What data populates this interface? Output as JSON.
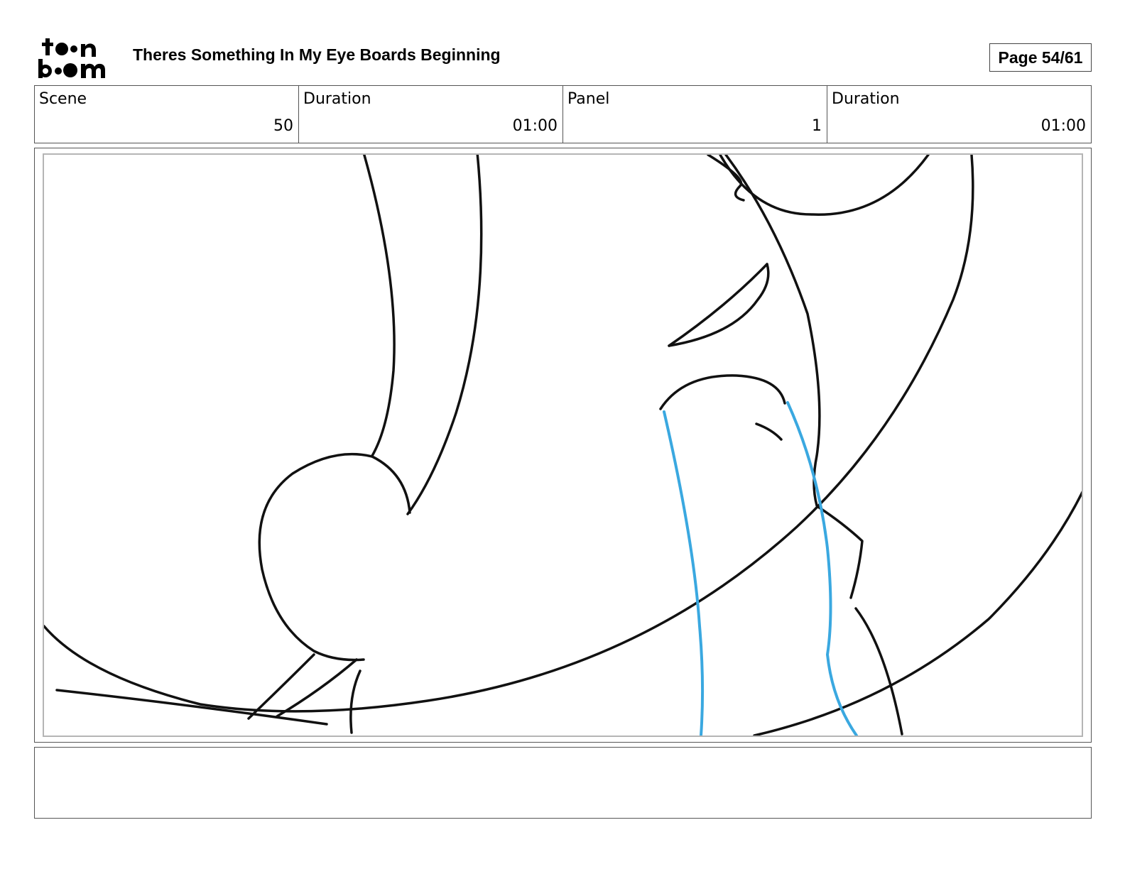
{
  "header": {
    "logo_text": "toonboom",
    "title": "Theres Something In My Eye Boards Beginning",
    "page_label": "Page 54/61"
  },
  "info": {
    "scene_label": "Scene",
    "scene_value": "50",
    "scene_duration_label": "Duration",
    "scene_duration_value": "01:00",
    "panel_label": "Panel",
    "panel_value": "1",
    "panel_duration_label": "Duration",
    "panel_duration_value": "01:00"
  },
  "notes": {
    "text": ""
  },
  "colors": {
    "line_color": "#111111",
    "tear_color": "#3aa8e0",
    "frame_border": "#555555",
    "safe_area_border": "#b5b5b5"
  }
}
